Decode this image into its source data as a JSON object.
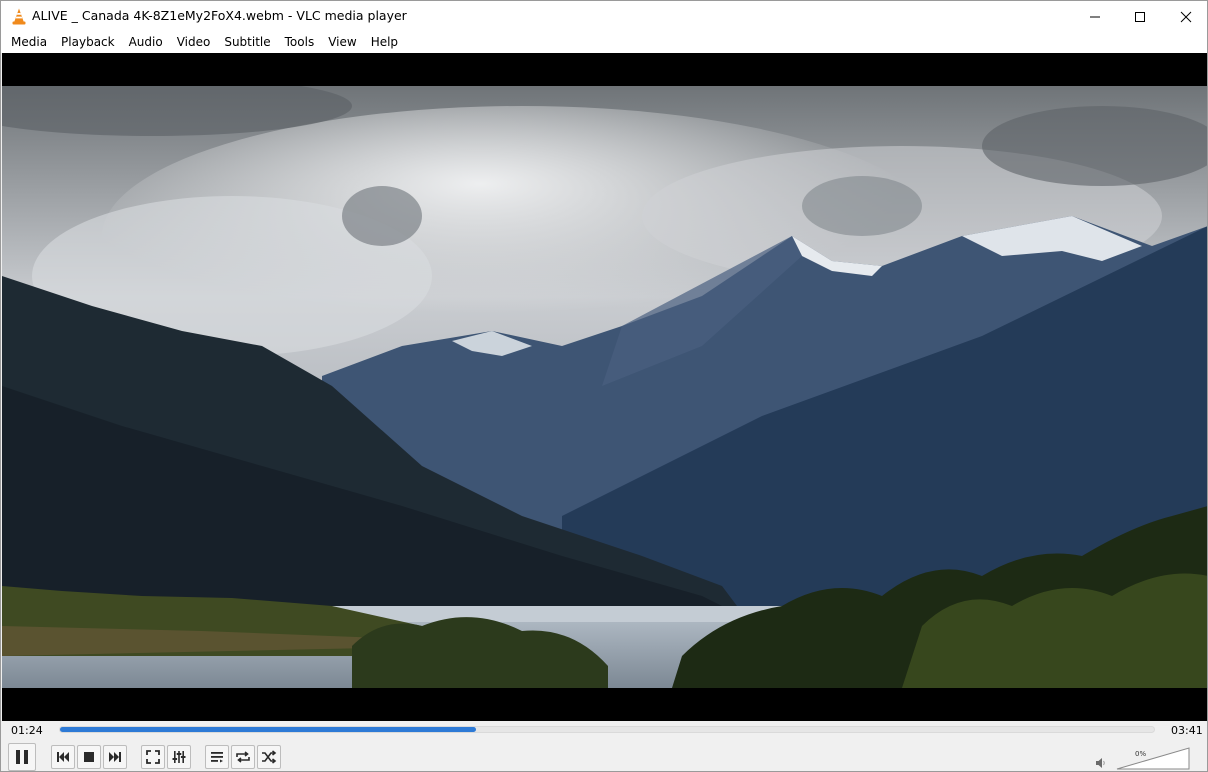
{
  "window": {
    "title": "ALIVE _ Canada 4K-8Z1eMy2FoX4.webm - VLC media player"
  },
  "menu": [
    "Media",
    "Playback",
    "Audio",
    "Video",
    "Subtitle",
    "Tools",
    "View",
    "Help"
  ],
  "player": {
    "elapsed": "01:24",
    "duration": "03:41",
    "progress_fraction": 0.38,
    "volume_label": "0%",
    "volume_fraction": 0.0
  },
  "colors": {
    "accent": "#2d7ad6",
    "vlc_orange": "#f08a1c"
  },
  "controls": {
    "icons": [
      "pause-icon",
      "previous-icon",
      "stop-icon",
      "next-icon",
      "fullscreen-icon",
      "extended-settings-icon",
      "playlist-icon",
      "loop-icon",
      "shuffle-icon",
      "volume-icon"
    ]
  }
}
